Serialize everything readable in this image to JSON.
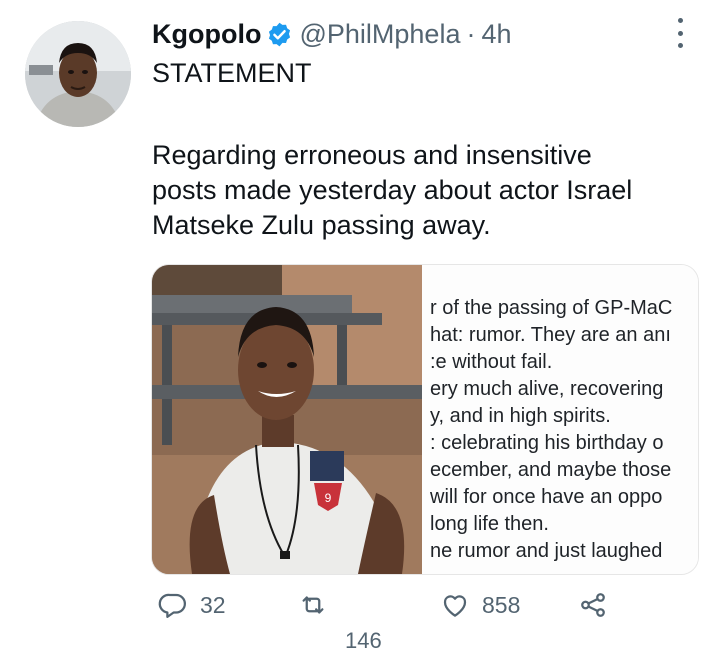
{
  "tweet": {
    "author_name": "Kgopolo",
    "handle": "@PhilMphela",
    "separator": "·",
    "time": "4h",
    "lines": [
      "STATEMENT",
      "Regarding erroneous and insensitive",
      "posts made yesterday about actor Israel",
      "Matseke Zulu passing away."
    ]
  },
  "media": {
    "document_lines": [
      "r of the passing of GP-MaC",
      "hat: rumor. They are an anı",
      ":e without fail.",
      "ery much alive, recovering",
      "y, and in high spirits.",
      ": celebrating his birthday o",
      "ecember, and maybe those",
      "will for once have an oppo",
      "long life then.",
      "ne rumor and just laughed"
    ]
  },
  "actions": {
    "reply_count": "32",
    "retweet_count": "",
    "like_count": "858",
    "below_count": "146"
  },
  "colors": {
    "verified": "#1d9bf0",
    "text": "#0f1419",
    "muted": "#536471"
  }
}
